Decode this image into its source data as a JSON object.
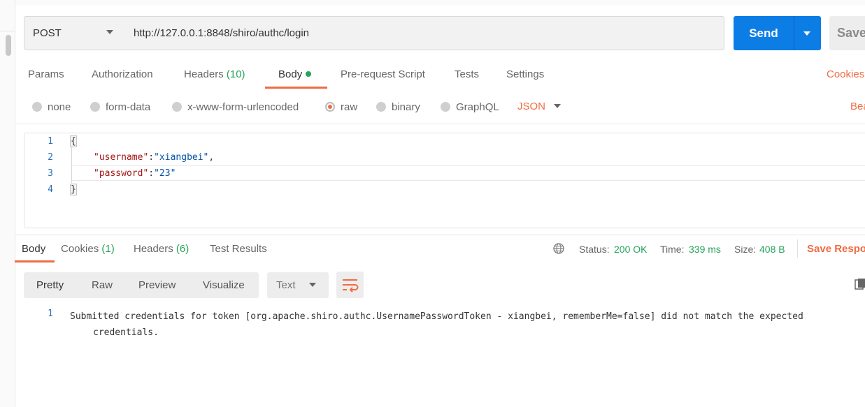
{
  "request": {
    "method": "POST",
    "url": "http://127.0.0.1:8848/shiro/authc/login",
    "send_label": "Send",
    "save_label": "Save"
  },
  "request_tabs": {
    "params": "Params",
    "authorization": "Authorization",
    "headers_label": "Headers",
    "headers_count": "(10)",
    "body": "Body",
    "prerequest": "Pre-request Script",
    "tests": "Tests",
    "settings": "Settings",
    "cookies": "Cookies"
  },
  "body_types": {
    "none": "none",
    "form_data": "form-data",
    "urlencoded": "x-www-form-urlencoded",
    "raw": "raw",
    "binary": "binary",
    "graphql": "GraphQL",
    "format": "JSON",
    "beautify": "Bea"
  },
  "editor": {
    "line_numbers": [
      "1",
      "2",
      "3",
      "4"
    ],
    "open_brace": "{",
    "close_brace": "}",
    "key1": "\"username\"",
    "val1": "\"xiangbei\"",
    "key2": "\"password\"",
    "val2": "\"23\""
  },
  "response_tabs": {
    "body": "Body",
    "cookies_label": "Cookies",
    "cookies_count": "(1)",
    "headers_label": "Headers",
    "headers_count": "(6)",
    "test_results": "Test Results"
  },
  "response_meta": {
    "status_label": "Status:",
    "status_value": "200 OK",
    "time_label": "Time:",
    "time_value": "339 ms",
    "size_label": "Size:",
    "size_value": "408 B",
    "save_response": "Save Respo"
  },
  "response_toolbar": {
    "pretty": "Pretty",
    "raw": "Raw",
    "preview": "Preview",
    "visualize": "Visualize",
    "text_format": "Text"
  },
  "response_body": {
    "line_number": "1",
    "line1": "Submitted credentials for token [org.apache.shiro.authc.UsernamePasswordToken - xiangbei, rememberMe=false] did not match the expected",
    "line2": "credentials."
  },
  "colors": {
    "accent": "#ef6c42",
    "send": "#0c7de5",
    "success": "#26a35a"
  }
}
